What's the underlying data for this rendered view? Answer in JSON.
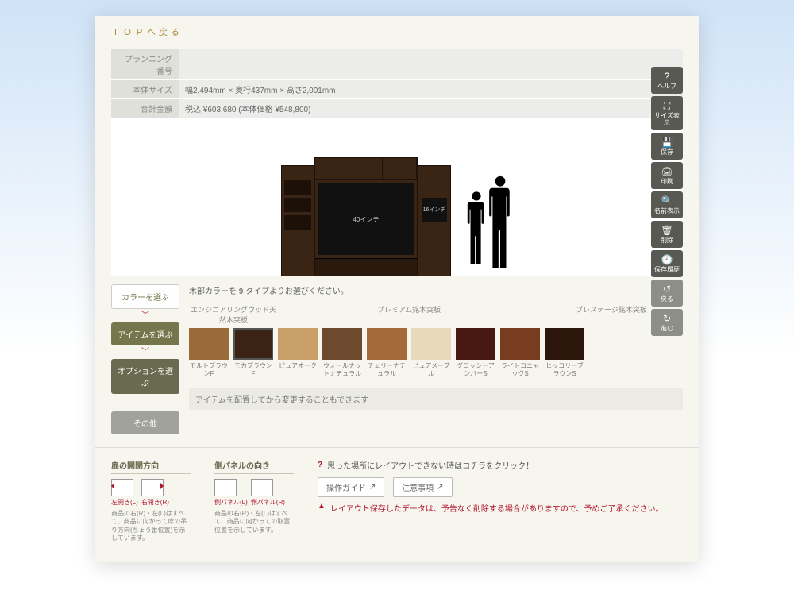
{
  "top_link": "ＴＯＰへ戻る",
  "header": {
    "rows": [
      {
        "label": "プランニング番号",
        "value": ""
      },
      {
        "label": "本体サイズ",
        "value": "幅2,494mm × 奥行437mm × 高さ2,001mm"
      },
      {
        "label": "合計金額",
        "value": "税込 ¥603,680 (本体価格 ¥548,800)"
      }
    ]
  },
  "canvas": {
    "tv_main_label": "40インチ",
    "tv_small_label": "16インチ"
  },
  "side_toolbar": [
    {
      "icon": "?",
      "label": "ヘルプ"
    },
    {
      "icon": "⛶",
      "label": "サイズ表示"
    },
    {
      "icon": "💾",
      "label": "保存"
    },
    {
      "icon": "🖨",
      "label": "印刷"
    },
    {
      "icon": "🔍",
      "label": "名前表示"
    },
    {
      "icon": "🗑",
      "label": "削除"
    },
    {
      "icon": "🕘",
      "label": "保存履歴"
    },
    {
      "icon": "↺",
      "label": "戻る",
      "muted": true
    },
    {
      "icon": "↻",
      "label": "進む",
      "muted": true
    }
  ],
  "steps": {
    "color": "カラーを選ぶ",
    "item": "アイテムを選ぶ",
    "option": "オプションを選ぶ",
    "other": "その他"
  },
  "swatch_panel": {
    "heading_pre": "木部カラーを ",
    "heading_bold": "9",
    "heading_post": " タイプよりお選びください。",
    "groups": {
      "g1": "エンジニアリングウッド天然木突板",
      "g2": "プレミアム銘木突板",
      "g3": "プレステージ銘木突板"
    },
    "swatches": [
      {
        "label": "モルトブラウンF",
        "color": "#9a6a39",
        "selected": false
      },
      {
        "label": "モカブラウンF",
        "color": "#3b2415",
        "selected": true
      },
      {
        "label": "ピュアオーク",
        "color": "#caa06a",
        "selected": false
      },
      {
        "label": "ウォールナットナチュラル",
        "color": "#6d4a2e",
        "selected": false
      },
      {
        "label": "チェリーナチュラル",
        "color": "#a46a3a",
        "selected": false
      },
      {
        "label": "ピュアメープル",
        "color": "#e8d9bb",
        "selected": false
      },
      {
        "label": "グロッシーアンバーS",
        "color": "#4a1812",
        "selected": false
      },
      {
        "label": "ライトコニャックS",
        "color": "#7a3c1e",
        "selected": false
      },
      {
        "label": "ヒッコリーブラウンS",
        "color": "#2c160c",
        "selected": false
      }
    ],
    "note": "アイテムを配置してから変更することもできます"
  },
  "bottom": {
    "legend1": {
      "title": "扉の開閉方向",
      "left_cap": "左開き(L)",
      "right_cap": "右開き(R)",
      "desc": "商品の右(R)・左(L)はすべて、商品に向かって扉の吊り方向(ちょう番位置)を示しています。"
    },
    "legend2": {
      "title": "側パネルの向き",
      "left_cap": "側パネル(L)",
      "right_cap": "側パネル(R)",
      "desc": "商品の右(R)・左(L)はすべて、商品に向かっての取置位置を示しています。"
    },
    "help": {
      "q_text": "思った場所にレイアウトできない時はコチラをクリック！",
      "btn1": "操作ガイド",
      "btn2": "注意事項",
      "warn": "レイアウト保存したデータは、予告なく削除する場合がありますので、予めご了承ください。"
    }
  }
}
